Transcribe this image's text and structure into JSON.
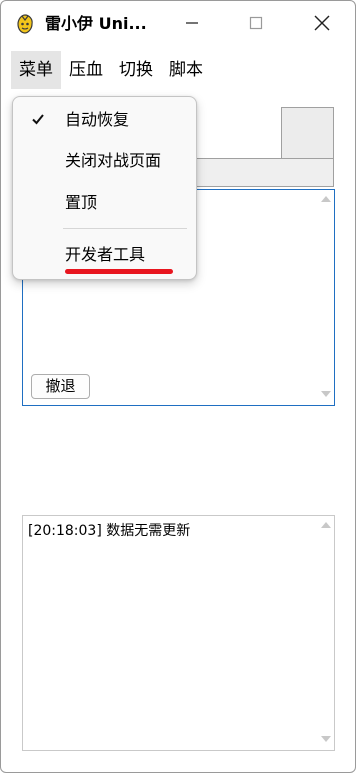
{
  "window": {
    "title": "雷小伊 Uni...",
    "minimize_glyph": "—",
    "maximize_glyph": "☐",
    "close_glyph": "✕"
  },
  "menubar": {
    "items": [
      {
        "label": "菜单"
      },
      {
        "label": "压血"
      },
      {
        "label": "切换"
      },
      {
        "label": "脚本"
      }
    ]
  },
  "dropdown": {
    "items": [
      {
        "label": "自动恢复",
        "checked": true
      },
      {
        "label": "关闭对战页面",
        "checked": false
      },
      {
        "label": "置顶",
        "checked": false
      },
      {
        "label": "开发者工具",
        "checked": false
      }
    ],
    "highlight_color": "#e8161f"
  },
  "editor": {
    "undo_label": "撤退"
  },
  "log": {
    "lines": [
      "[20:18:03] 数据无需更新"
    ]
  },
  "colors": {
    "focus_border": "#1f6fc2",
    "menu_active_bg": "#e5e5e5"
  }
}
